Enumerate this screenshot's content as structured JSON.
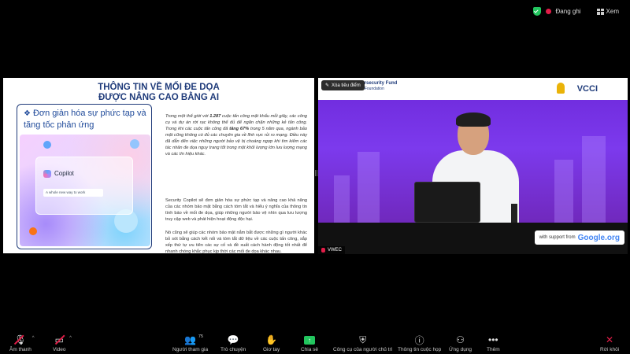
{
  "status": {
    "recording_label": "Đang ghi",
    "view_label": "Xem"
  },
  "slide": {
    "title_line1": "THÔNG TIN VỀ MỐI ĐE DỌA",
    "title_line2": "ĐƯỢC NÂNG CAO BẰNG AI",
    "bullet_heading": "Đơn giản hóa sự phức tạp và tăng tốc phản ứng",
    "copilot_name": "Copilot",
    "copilot_tagline": "A whole new way to work",
    "paragraph1_a": "Trong một thế giới với ",
    "paragraph1_b": "1.287",
    "paragraph1_c": " cuộc tấn công mật khẩu mỗi giây, các công cụ và dự án rời rạc không thể đủ để ngăn chặn những kẻ tấn công. Trong khi các cuộc tấn công đã ",
    "paragraph1_d": "tăng 67%",
    "paragraph1_e": " trong 5 năm qua, ngành bảo mật cũng không có đủ các chuyên gia về lĩnh vực rủi ro mạng. Điều này đã dẫn đến việc những người bảo vệ bị choáng ngợp khi tìm kiếm các tác nhân đe dọa nguy trang tốt trong một khối lượng lớn lưu lượng mạng và các tín hiệu khác.",
    "paragraph2": "Security Copilot sẽ đơn giản hóa sự phức tạp và nâng cao khả năng của các nhóm bảo mật bằng cách tóm tắt và hiểu ý nghĩa của thông tin tình báo về mối đe dọa, giúp những người bảo vệ nhìn qua lưu lượng truy cập web và phát hiện hoạt động độc hại.",
    "paragraph3": "Nó cũng sẽ giúp các nhóm bảo mật nắm bắt được những gì người khác bỏ sót bằng cách kết nối và tóm tắt dữ liệu về các cuộc tấn công, sắp xếp thứ tự ưu tiên các sự cố và đề xuất cách hành động tốt nhất để nhanh chóng khắc phục kịp thời các mối đe dọa khác nhau."
  },
  "video": {
    "focus_button": "Xóa tiêu điểm",
    "sponsor_main": "C Cybersecurity Fund",
    "sponsor_sub": "The Asia Foundation",
    "brand": "VCCI",
    "support_label": "with support from",
    "support_brand": "Google.org",
    "participant_name": "VWEC"
  },
  "toolbar": {
    "audio": "Âm thanh",
    "video": "Video",
    "participants": "Người tham gia",
    "participants_count": "75",
    "chat": "Trò chuyện",
    "react": "Giơ tay",
    "share": "Chia sẻ",
    "host_tools": "Công cụ của người chủ trì",
    "meeting_info": "Thông tin cuộc họp",
    "apps": "Ứng dụng",
    "more": "Thêm",
    "leave": "Rời khỏi"
  },
  "colors": {
    "slide_title": "#1f3b7a",
    "video_bg": "#7c3aed",
    "share_green": "#22c55e",
    "leave_red": "#e11d48"
  }
}
